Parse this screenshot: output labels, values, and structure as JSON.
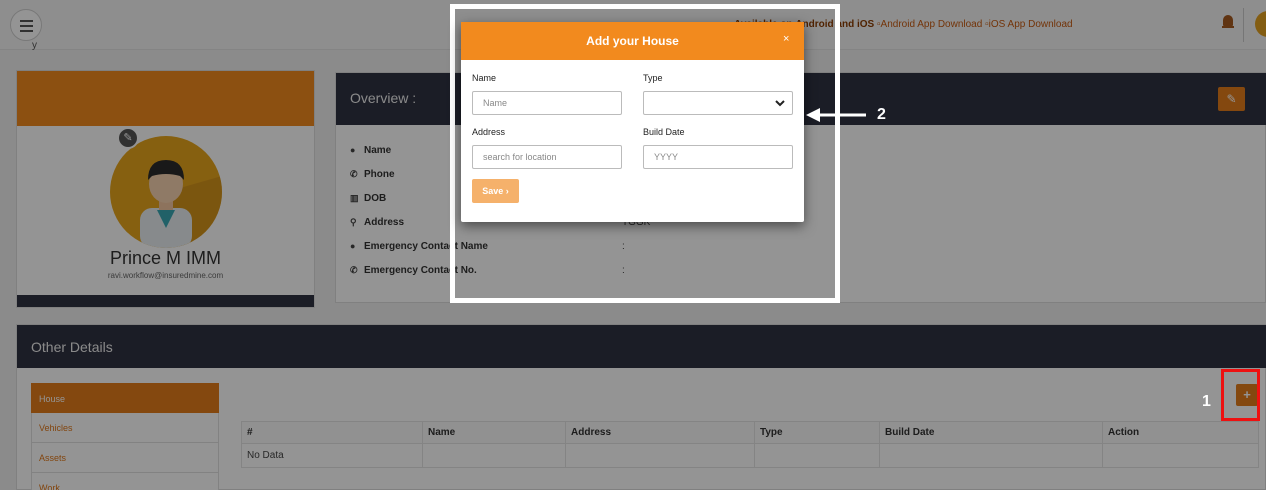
{
  "topbar": {
    "available_prefix": "Available on",
    "available_platforms": "Android and iOS",
    "android_alt": "Android App Download",
    "ios_alt": "iOS App Download",
    "crumb_fragment": "y"
  },
  "profile": {
    "name": "Prince M IMM",
    "email": "ravi.workflow@insuredmine.com"
  },
  "overview": {
    "title": "Overview :",
    "fields": [
      {
        "label": "Name",
        "icon": "user-icon"
      },
      {
        "label": "Phone",
        "icon": "phone-icon"
      },
      {
        "label": "DOB",
        "icon": "cake-icon"
      },
      {
        "label": "Address",
        "icon": "map-marker-icon"
      },
      {
        "label": "Emergency Contact Name",
        "icon": "user-icon"
      },
      {
        "label": "Emergency Contact No.",
        "icon": "phone-icon"
      }
    ],
    "address_value_partial": "TGGK",
    "colon": ":"
  },
  "other_details": {
    "title": "Other Details",
    "tabs": [
      "House",
      "Vehicles",
      "Assets",
      "Work"
    ],
    "active_tab": "House",
    "table": {
      "columns": [
        "#",
        "Name",
        "Address",
        "Type",
        "Build Date",
        "Action"
      ],
      "empty_text": "No Data"
    },
    "add_label": "+"
  },
  "modal": {
    "title": "Add your House",
    "close": "×",
    "name_label": "Name",
    "name_placeholder": "Name",
    "type_label": "Type",
    "type_value": "",
    "address_label": "Address",
    "address_placeholder": "search for location",
    "build_date_label": "Build Date",
    "build_date_placeholder": "YYYY",
    "save_label": "Save ›"
  },
  "annotations": {
    "callout_1": "1",
    "callout_2": "2",
    "highlight_color": "#ee1111"
  },
  "colors": {
    "accent": "#f28a1e",
    "dark_header": "#2f3243"
  }
}
